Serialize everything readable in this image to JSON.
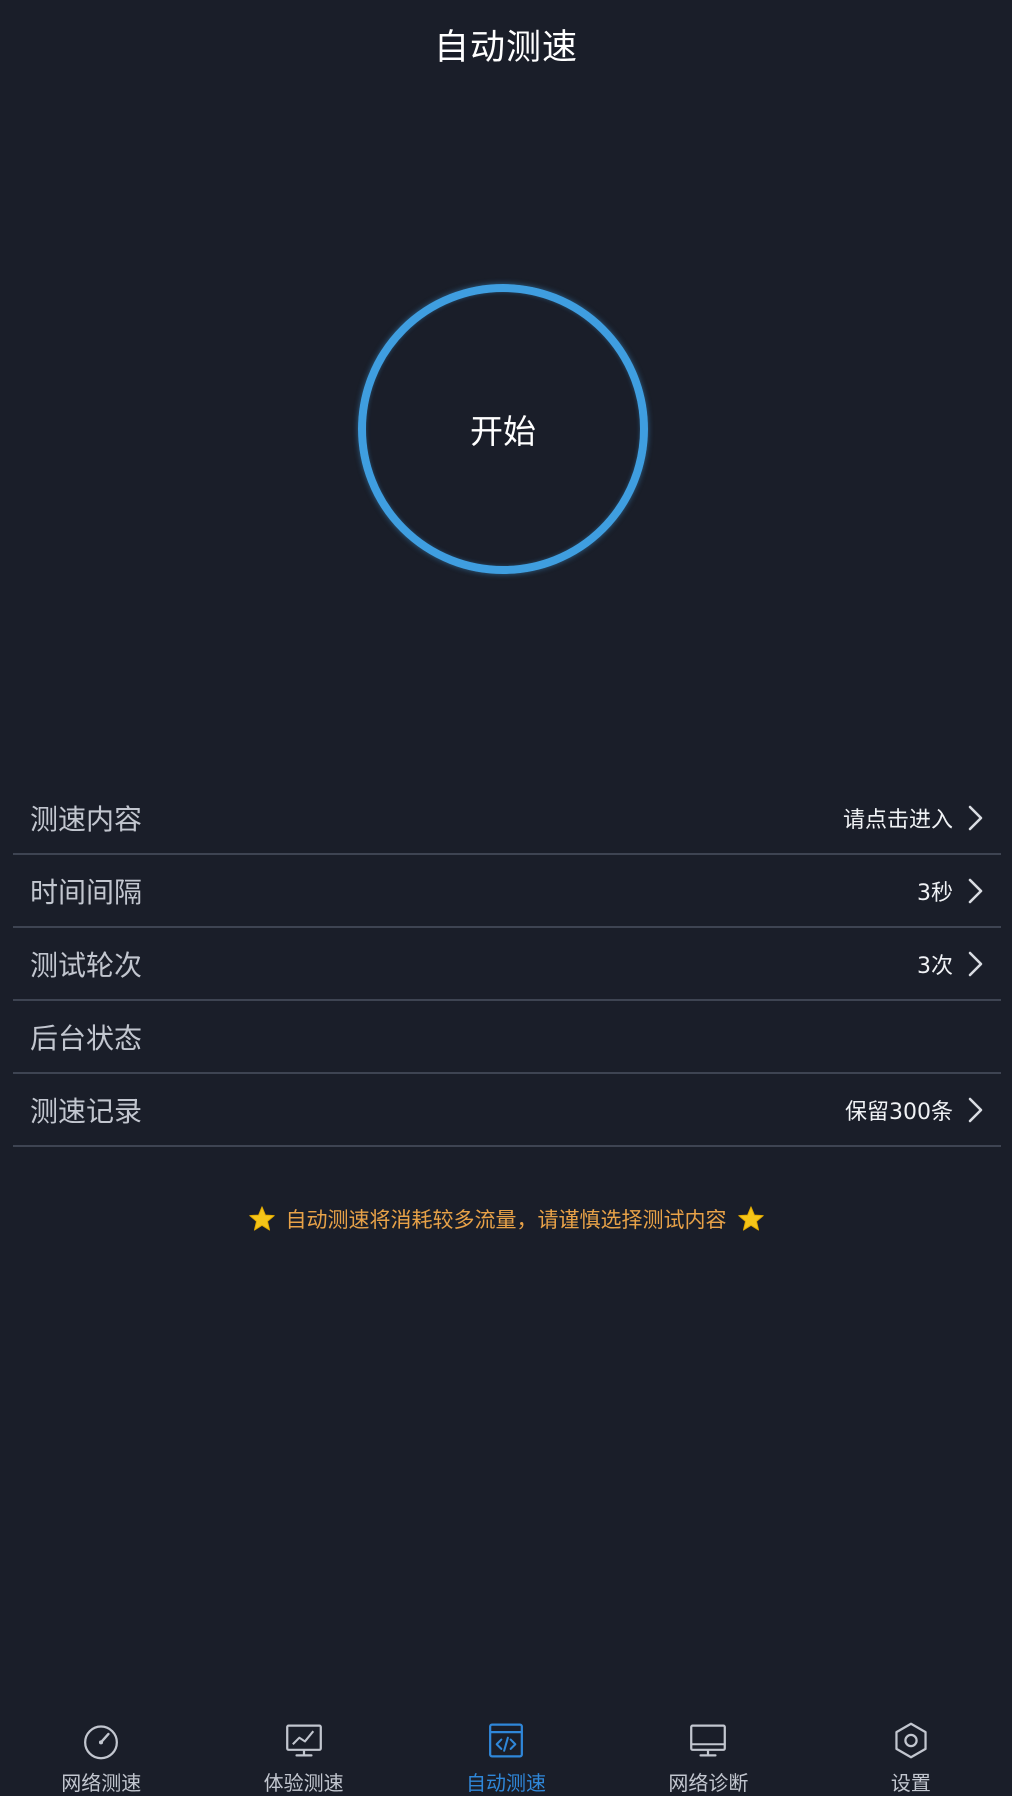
{
  "header": {
    "title": "自动测速"
  },
  "start_button": {
    "label": "开始"
  },
  "settings": {
    "items": [
      {
        "label": "测速内容",
        "value": "请点击进入"
      },
      {
        "label": "时间间隔",
        "value": "3秒"
      },
      {
        "label": "测试轮次",
        "value": "3次"
      },
      {
        "label": "后台状态",
        "value": ""
      },
      {
        "label": "测速记录",
        "value": "保留300条"
      }
    ]
  },
  "notice": {
    "text": "自动测速将消耗较多流量，请谨慎选择测试内容"
  },
  "tabbar": {
    "tabs": [
      {
        "label": "网络测速",
        "icon": "speedometer-icon"
      },
      {
        "label": "体验测速",
        "icon": "monitor-chart-icon"
      },
      {
        "label": "自动测速",
        "icon": "browser-code-icon"
      },
      {
        "label": "网络诊断",
        "icon": "desktop-icon"
      },
      {
        "label": "设置",
        "icon": "hexagon-settings-icon"
      }
    ],
    "active_index": 2
  },
  "colors": {
    "background": "#1a1e29",
    "accent": "#3f9ee0",
    "active_tab": "#2f87d9",
    "notice": "#e8a248",
    "star": "#f5c518"
  }
}
